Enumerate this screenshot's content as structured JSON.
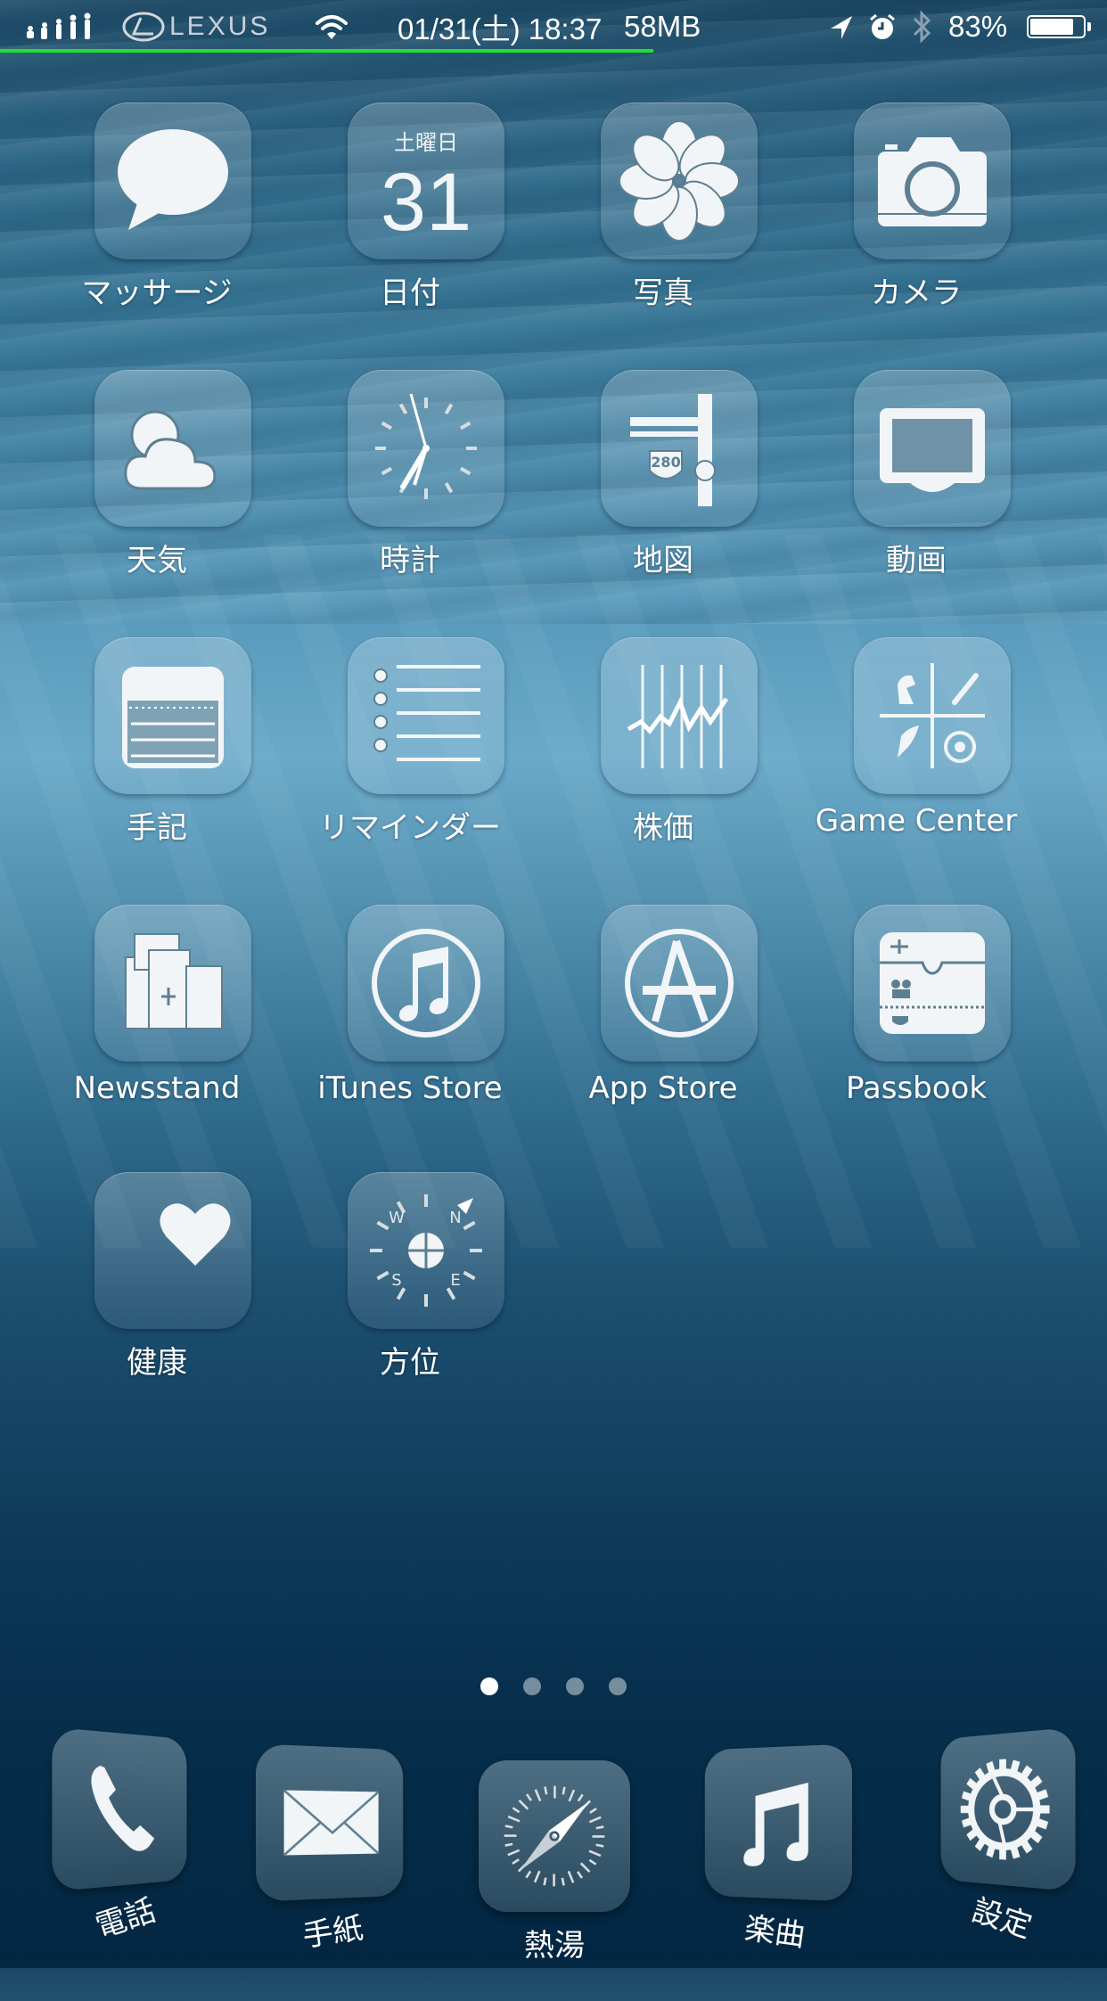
{
  "status_bar": {
    "carrier_logo": "lexus-logo",
    "carrier_text": "LEXUS",
    "datetime": "01/31(土) 18:37",
    "memory": "58MB",
    "battery_percent_text": "83%",
    "battery_level": 0.83,
    "memory_progress": 0.59,
    "progress_color": "#22e02a",
    "icons": [
      "evolution-icon",
      "lexus-logo-icon",
      "wifi-icon",
      "location-arrow-icon",
      "alarm-icon",
      "bluetooth-icon",
      "battery-icon"
    ]
  },
  "apps": [
    {
      "label": "マッサージ",
      "icon": "messages-icon"
    },
    {
      "label": "日付",
      "icon": "calendar-icon",
      "weekday": "土曜日",
      "day": "31"
    },
    {
      "label": "写真",
      "icon": "photos-icon"
    },
    {
      "label": "カメラ",
      "icon": "camera-icon"
    },
    {
      "label": "天気",
      "icon": "weather-icon"
    },
    {
      "label": "時計",
      "icon": "clock-icon"
    },
    {
      "label": "地図",
      "icon": "maps-icon",
      "badge_text": "280"
    },
    {
      "label": "動画",
      "icon": "videos-icon"
    },
    {
      "label": "手記",
      "icon": "notes-icon"
    },
    {
      "label": "リマインダー",
      "icon": "reminders-icon"
    },
    {
      "label": "株価",
      "icon": "stocks-icon"
    },
    {
      "label": "Game Center",
      "icon": "game-center-icon"
    },
    {
      "label": "Newsstand",
      "icon": "newsstand-icon"
    },
    {
      "label": "iTunes Store",
      "icon": "itunes-store-icon"
    },
    {
      "label": "App Store",
      "icon": "app-store-icon"
    },
    {
      "label": "Passbook",
      "icon": "passbook-icon"
    },
    {
      "label": "健康",
      "icon": "health-icon"
    },
    {
      "label": "方位",
      "icon": "compass-icon",
      "directions": [
        "W",
        "N",
        "S",
        "E"
      ]
    }
  ],
  "page_indicator": {
    "total": 4,
    "current": 1
  },
  "dock": [
    {
      "label": "電話",
      "icon": "phone-icon"
    },
    {
      "label": "手紙",
      "icon": "mail-icon"
    },
    {
      "label": "熱湯",
      "icon": "safari-icon"
    },
    {
      "label": "楽曲",
      "icon": "music-icon"
    },
    {
      "label": "設定",
      "icon": "settings-icon"
    }
  ]
}
